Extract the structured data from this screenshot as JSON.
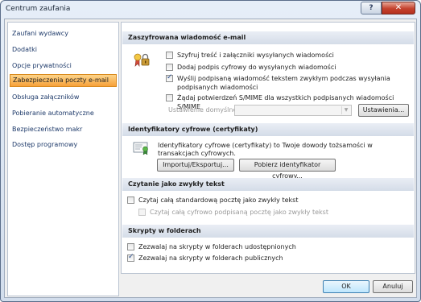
{
  "window": {
    "title": "Centrum zaufania",
    "help_glyph": "?",
    "close_glyph": "✕"
  },
  "sidebar": {
    "items": [
      {
        "label": "Zaufani wydawcy"
      },
      {
        "label": "Dodatki"
      },
      {
        "label": "Opcje prywatności"
      },
      {
        "label": "Zabezpieczenia poczty e-mail",
        "selected": true
      },
      {
        "label": "Obsługa załączników"
      },
      {
        "label": "Pobieranie automatyczne"
      },
      {
        "label": "Bezpieczeństwo makr"
      },
      {
        "label": "Dostęp programowy"
      }
    ]
  },
  "encrypted": {
    "header": "Zaszyfrowana wiadomość e-mail",
    "options": [
      {
        "label": "Szyfruj treść i załączniki wysyłanych wiadomości",
        "checked": false
      },
      {
        "label": "Dodaj podpis cyfrowy do wysyłanych wiadomości",
        "checked": false
      },
      {
        "label": "Wyślij podpisaną wiadomość tekstem zwykłym podczas wysyłania podpisanych wiadomości",
        "checked": true
      },
      {
        "label": "Żądaj potwierdzeń S/MIME dla wszystkich podpisanych wiadomości S/MIME",
        "checked": false
      }
    ],
    "default_setting_label": "Ustawienie domyślne:",
    "default_setting_value": "",
    "settings_button": "Ustawienia..."
  },
  "digital_ids": {
    "header": "Identyfikatory cyfrowe (certyfikaty)",
    "description": "Identyfikatory cyfrowe (certyfikaty) to Twoje dowody tożsamości w transakcjach cyfrowych.",
    "import_export_button": "Importuj/Eksportuj...",
    "get_id_button": "Pobierz identyfikator cyfrowy..."
  },
  "plain_text": {
    "header": "Czytanie jako zwykły tekst",
    "options": [
      {
        "label": "Czytaj całą standardową pocztę jako zwykły tekst",
        "checked": false,
        "disabled": false
      },
      {
        "label": "Czytaj całą cyfrowo podpisaną pocztę jako zwykły tekst",
        "checked": false,
        "disabled": true
      }
    ]
  },
  "scripts": {
    "header": "Skrypty w folderach",
    "options": [
      {
        "label": "Zezwalaj na skrypty w folderach udostępnionych",
        "checked": false
      },
      {
        "label": "Zezwalaj na skrypty w folderach publicznych",
        "checked": true
      }
    ]
  },
  "footer": {
    "ok_button": "OK",
    "cancel_button": "Anuluj"
  },
  "icons": {
    "check": "✓",
    "dropdown": "▼"
  }
}
